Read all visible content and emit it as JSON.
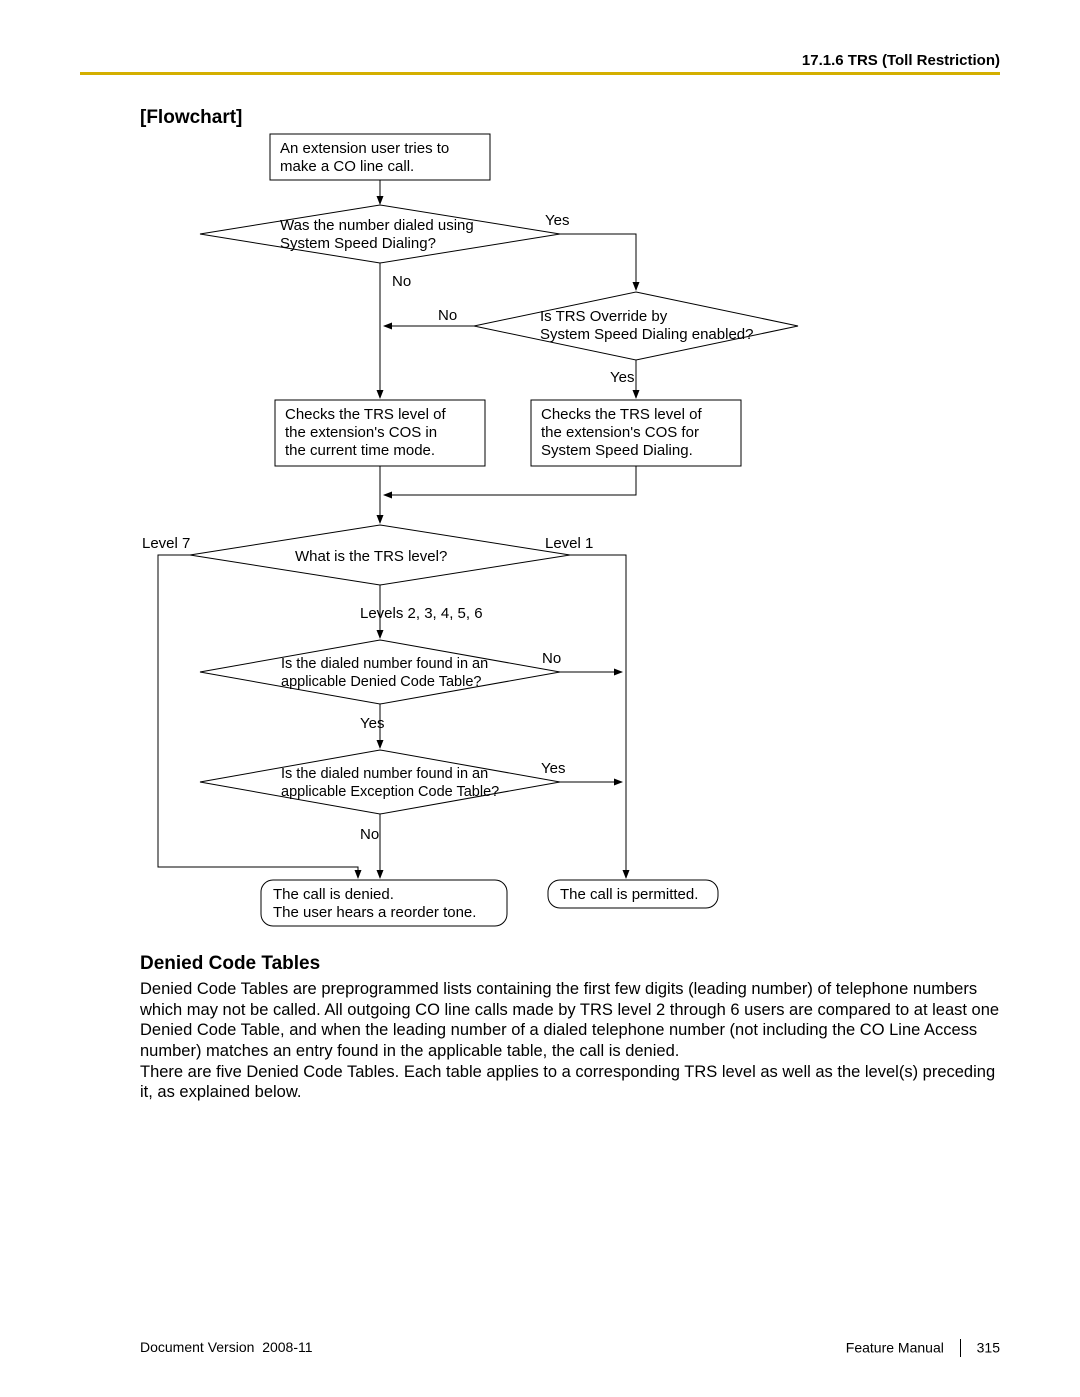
{
  "header": {
    "section_ref": "17.1.6 TRS (Toll Restriction)"
  },
  "titles": {
    "flowchart": "[Flowchart]",
    "denied_tables": "Denied Code Tables"
  },
  "flow": {
    "start": {
      "line1": "An extension user tries to",
      "line2": "make a CO line call."
    },
    "d1": {
      "line1": "Was the number dialed using",
      "line2": "System Speed Dialing?",
      "yes": "Yes",
      "no": "No"
    },
    "d2": {
      "line1": "Is TRS Override by",
      "line2": "System Speed Dialing enabled?",
      "yes": "Yes",
      "no": "No"
    },
    "p1": {
      "line1": "Checks the TRS level of",
      "line2": "the extension's COS in",
      "line3": "the current time mode."
    },
    "p2": {
      "line1": "Checks the TRS level of",
      "line2": "the extension's COS for",
      "line3": "System Speed Dialing."
    },
    "d3": {
      "text": "What is the TRS level?",
      "left": "Level  7",
      "right": "Level  1",
      "bottom": "Levels  2, 3, 4, 5, 6"
    },
    "d4": {
      "line1": "Is the dialed number found in an",
      "line2": "applicable Denied Code Table?",
      "yes": "Yes",
      "no": "No"
    },
    "d5": {
      "line1": "Is the dialed number found in an",
      "line2": "applicable Exception Code Table?",
      "yes": "Yes",
      "no": "No"
    },
    "t1": {
      "line1": "The call is denied.",
      "line2": "The user hears a reorder tone."
    },
    "t2": {
      "text": "The call is permitted."
    }
  },
  "paragraph": "Denied Code Tables are preprogrammed lists containing the first few digits (leading number) of telephone numbers which may not be called. All outgoing CO line calls made by TRS level 2 through 6 users are compared to at least one Denied Code Table, and when the leading number of a dialed telephone number (not including the CO Line Access number) matches an entry found in the applicable table, the call is denied.\nThere are five Denied Code Tables. Each table applies to a corresponding TRS level as well as the level(s) preceding it, as explained below.",
  "footer": {
    "doc_version_label": "Document Version",
    "doc_version_value": "2008-11",
    "manual": "Feature Manual",
    "page": "315"
  }
}
